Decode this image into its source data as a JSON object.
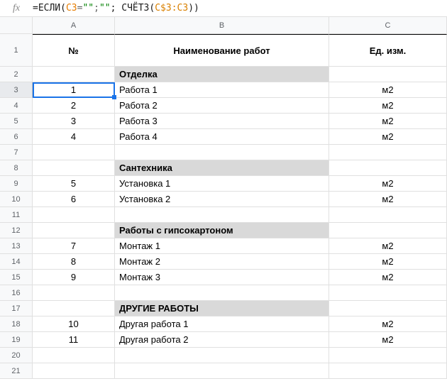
{
  "formula": {
    "fx_label": "fx",
    "parts": {
      "p0": "=ЕСЛИ(",
      "p1": "C3",
      "p2": "=",
      "p3": "\"\"",
      "p4": ";",
      "p5": "\"\"",
      "p6": "; СЧЁТЗ(",
      "p7": "C$3:C3",
      "p8": "))"
    }
  },
  "columns": {
    "A": "A",
    "B": "B",
    "C": "C"
  },
  "headers": {
    "num": "№",
    "name": "Наименование работ",
    "unit": "Ед. изм."
  },
  "selected_cell": "A3",
  "chart_data": {
    "type": "table",
    "columns": [
      "№",
      "Наименование работ",
      "Ед. изм."
    ],
    "rows": [
      {
        "num": "",
        "name": "Отделка",
        "unit": "",
        "group": true
      },
      {
        "num": "1",
        "name": "Работа 1",
        "unit": "м2"
      },
      {
        "num": "2",
        "name": "Работа 2",
        "unit": "м2"
      },
      {
        "num": "3",
        "name": "Работа 3",
        "unit": "м2"
      },
      {
        "num": "4",
        "name": "Работа 4",
        "unit": "м2"
      },
      {
        "num": "",
        "name": "",
        "unit": ""
      },
      {
        "num": "",
        "name": "Сантехника",
        "unit": "",
        "group": true
      },
      {
        "num": "5",
        "name": "Установка 1",
        "unit": "м2"
      },
      {
        "num": "6",
        "name": "Установка 2",
        "unit": "м2"
      },
      {
        "num": "",
        "name": "",
        "unit": ""
      },
      {
        "num": "",
        "name": "Работы с гипсокартоном",
        "unit": "",
        "group": true
      },
      {
        "num": "7",
        "name": "Монтаж 1",
        "unit": "м2"
      },
      {
        "num": "8",
        "name": "Монтаж 2",
        "unit": "м2"
      },
      {
        "num": "9",
        "name": "Монтаж 3",
        "unit": "м2"
      },
      {
        "num": "",
        "name": "",
        "unit": ""
      },
      {
        "num": "",
        "name": "ДРУГИЕ РАБОТЫ",
        "unit": "",
        "group": true
      },
      {
        "num": "10",
        "name": "Другая работа 1",
        "unit": "м2"
      },
      {
        "num": "11",
        "name": "Другая работа 2",
        "unit": "м2"
      },
      {
        "num": "",
        "name": "",
        "unit": ""
      },
      {
        "num": "",
        "name": "",
        "unit": ""
      }
    ]
  },
  "row_labels": [
    "1",
    "2",
    "3",
    "4",
    "5",
    "6",
    "7",
    "8",
    "9",
    "10",
    "11",
    "12",
    "13",
    "14",
    "15",
    "16",
    "17",
    "18",
    "19",
    "20",
    "21"
  ]
}
